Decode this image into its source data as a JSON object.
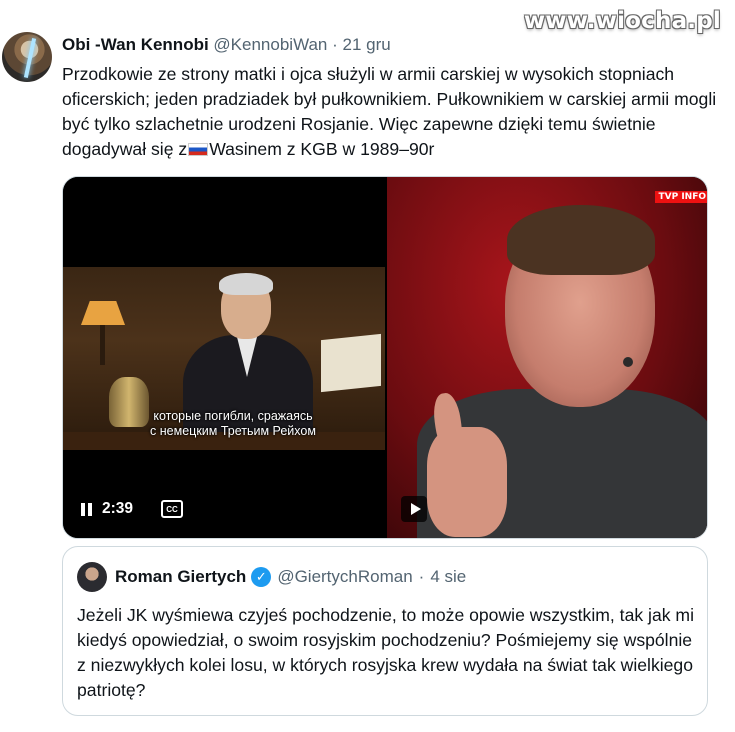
{
  "watermark": "www.wiocha.pl",
  "tweet": {
    "author_name": "Obi -Wan Kennobi",
    "handle": "@KennobiWan",
    "separator": "·",
    "date": "21 gru",
    "text_before_flag": "Przodkowie ze strony matki i ojca służyli w armii carskiej w wysokich stopniach oficerskich; jeden pradziadek był pułkownikiem. Pułkownikiem w carskiej armii mogli być tylko szlachetnie urodzeni Rosjanie. Więc zapewne dzięki temu świetnie dogadywał się z",
    "flag_icon": "russian-flag-icon",
    "text_after_flag": "Wasinem z KGB w 1989–90r"
  },
  "video_left": {
    "subtitle_line1": "которые погибли, сражаясь",
    "subtitle_line2": "с немецким Третьим Рейхом",
    "time": "2:39",
    "cc_label": "CC",
    "pause_icon": "pause-icon",
    "cc_icon": "closed-captions-icon"
  },
  "video_right": {
    "channel_logo": "TVP INFO",
    "play_icon": "play-icon"
  },
  "quoted_tweet": {
    "author_name": "Roman Giertych",
    "verified_icon": "verified-badge-icon",
    "handle": "@GiertychRoman",
    "separator": "·",
    "date": "4 sie",
    "text": "Jeżeli JK wyśmiewa czyjeś pochodzenie, to może opowie wszystkim, tak jak mi kiedyś opowiedział, o swoim rosyjskim pochodzeniu? Pośmiejemy się wspólnie z niezwykłych kolei losu, w których rosyjska krew wydała na świat tak wielkiego patriotę?"
  },
  "colors": {
    "text": "#0f1419",
    "secondary_text": "#536471",
    "border": "#cfd9de",
    "verified_blue": "#1d9bf0"
  }
}
